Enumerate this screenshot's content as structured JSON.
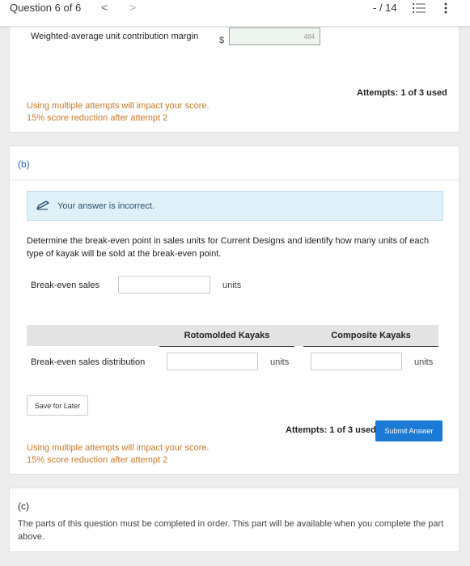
{
  "topbar": {
    "question_label": "Question 6 of 6",
    "prev_glyph": "<",
    "next_glyph": ">",
    "score": "- / 14",
    "icons": [
      "list-icon",
      "more-vertical-icon"
    ]
  },
  "part_a": {
    "margin_label": "Weighted-average unit contribution margin",
    "currency": "$",
    "margin_value": "484",
    "attempts": "Attempts: 1 of 3 used",
    "note_line1": "Using multiple attempts will impact your score.",
    "note_line2": "15% score reduction after attempt 2"
  },
  "part_b": {
    "letter": "(b)",
    "alert": "Your answer is incorrect.",
    "description": "Determine the break-even point in sales units for Current Designs and identify how many units of each type of kayak will be sold at the break-even point.",
    "break_even_label": "Break-even sales",
    "break_even_value": "",
    "unit_label": "units",
    "table": {
      "col1": "Rotomolded Kayaks",
      "col2": "Composite Kayaks",
      "row_label": "Break-even sales distribution",
      "rotomolded_value": "",
      "composite_value": ""
    },
    "save_button": "Save for Later",
    "attempts": "Attempts: 1 of 3 used",
    "submit_button": "Submit Answer",
    "note_line1": "Using multiple attempts will impact your score.",
    "note_line2": "15% score reduction after attempt 2"
  },
  "part_c": {
    "letter": "(c)",
    "text": "The parts of this question must be completed in order. This part will be available when you complete the part above."
  },
  "colors": {
    "accent": "#1a7ad6",
    "warning_text": "#c77a2a",
    "alert_bg": "#dff0f8"
  }
}
